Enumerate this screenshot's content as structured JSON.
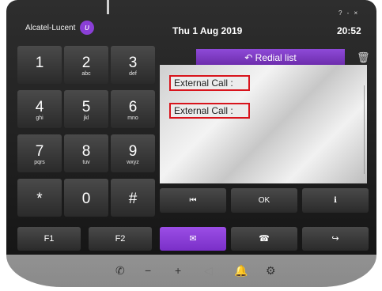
{
  "header": {
    "brand": "Alcatel-Lucent",
    "brand_logo": "ʋ",
    "window_controls": "? - ×",
    "date": "Thu 1 Aug 2019",
    "time": "20:52"
  },
  "keypad": [
    {
      "digit": "1",
      "letters": ""
    },
    {
      "digit": "2",
      "letters": "abc"
    },
    {
      "digit": "3",
      "letters": "def"
    },
    {
      "digit": "4",
      "letters": "ghi"
    },
    {
      "digit": "5",
      "letters": "jkl"
    },
    {
      "digit": "6",
      "letters": "mno"
    },
    {
      "digit": "7",
      "letters": "pqrs"
    },
    {
      "digit": "8",
      "letters": "tuv"
    },
    {
      "digit": "9",
      "letters": "wxyz"
    },
    {
      "digit": "*",
      "letters": ""
    },
    {
      "digit": "0",
      "letters": ""
    },
    {
      "digit": "#",
      "letters": ""
    }
  ],
  "redial": {
    "tab_label": "↶ Redial list",
    "trash_icon": "🗑",
    "entries": [
      "External Call :",
      "External Call :"
    ]
  },
  "nav": {
    "first_icon": "⏮",
    "ok_label": "OK",
    "info_icon": "ℹ",
    "next_icon": "➜"
  },
  "function_keys": {
    "f1_label": "F1",
    "f2_label": "F2",
    "mail_icon": "✉",
    "hangup_icon": "☎",
    "transfer_icon": "↪"
  },
  "bottom_bar": {
    "handset_icon": "✆",
    "minus_icon": "−",
    "plus_icon": "+",
    "speaker_icon": "◁",
    "bell_icon": "🔔",
    "settings_icon": "⚙"
  },
  "colors": {
    "accent_purple": "#7a2fc8",
    "highlight_red": "#d8141c"
  }
}
